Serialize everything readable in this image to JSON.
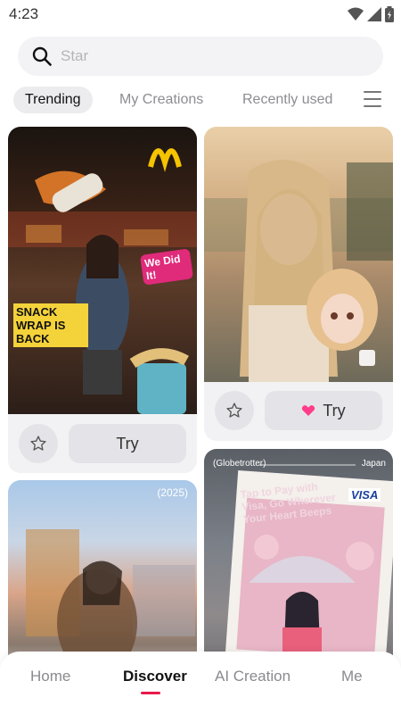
{
  "status_bar": {
    "time": "4:23",
    "icons": [
      "wifi-icon",
      "signal-icon",
      "battery-icon"
    ]
  },
  "search": {
    "placeholder": "Star",
    "value": ""
  },
  "tabs": [
    {
      "label": "Trending",
      "active": true
    },
    {
      "label": "My Creations",
      "active": false
    },
    {
      "label": "Recently used",
      "active": false
    }
  ],
  "feed": [
    {
      "try_label": "Try",
      "overlay_texts": [
        "SNACK WRAP IS BACK",
        "We Did It!"
      ]
    },
    {
      "try_label": "Try",
      "premium": true
    },
    {
      "overlay_texts": [
        "(2025)"
      ]
    },
    {
      "overlay_texts": [
        "(Globetrotter)",
        "Japan",
        "Tap to Pay with Visa, Go Wherever Your Heart Beeps",
        "VISA"
      ]
    }
  ],
  "bottom_nav": [
    {
      "label": "Home",
      "active": false
    },
    {
      "label": "Discover",
      "active": true
    },
    {
      "label": "AI Creation",
      "active": false
    },
    {
      "label": "Me",
      "active": false
    }
  ],
  "colors": {
    "accent": "#e8194a",
    "premium_heart": "#ff3d8b",
    "card_bg": "#f2f2f4",
    "button_bg": "#e4e4e8"
  }
}
